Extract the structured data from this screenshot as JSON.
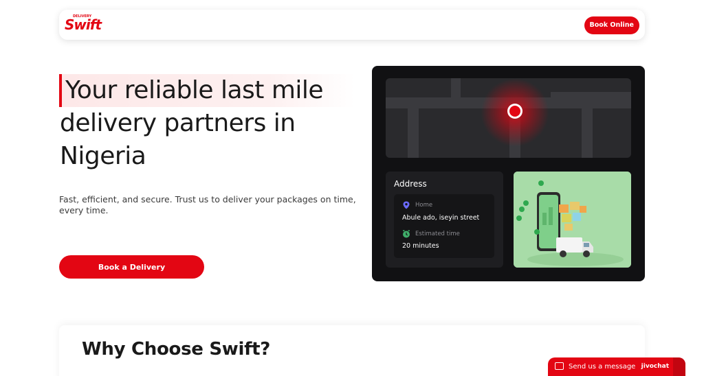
{
  "header": {
    "logo_text": "Swift",
    "logo_tagline": "DELIVERY",
    "book_online_label": "Book Online"
  },
  "hero": {
    "title_line1": "Your reliable last mile",
    "title_line2": "delivery partners in",
    "title_line3": "Nigeria",
    "subtitle": "Fast, efficient, and secure. Trust us to deliver your packages on time, every time.",
    "cta_label": "Book a Delivery"
  },
  "card": {
    "address_title": "Address",
    "home_label": "Home",
    "home_value": "Abule ado, iseyin street",
    "time_label": "Estimated time",
    "time_value": "20 minutes"
  },
  "why": {
    "title": "Why Choose Swift?"
  },
  "chat": {
    "label": "Send us a message",
    "brand": "jivochat"
  },
  "colors": {
    "brand_red": "#e30613",
    "card_dark": "#111113",
    "illustration_green": "#a8dca8",
    "home_pin_blue": "#6b6bff",
    "clock_green": "#3fae6a"
  }
}
